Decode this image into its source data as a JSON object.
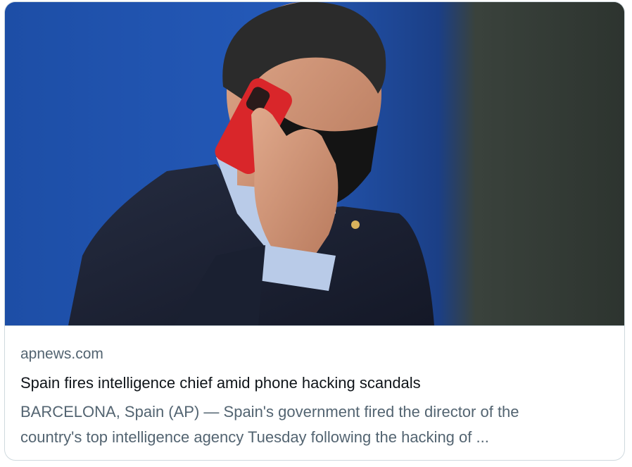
{
  "card": {
    "domain": "apnews.com",
    "title": "Spain fires intelligence chief amid phone hacking scandals",
    "description_line1": "BARCELONA, Spain (AP) — Spain's government fired the director of the",
    "description_line2": "country's top intelligence agency Tuesday following the hacking of ..."
  },
  "colors": {
    "border": "#cfd9de",
    "domain_text": "#536471",
    "title_text": "#0f1419",
    "photo_background": "#2459b8",
    "phone_case": "#d9262a",
    "suit": "#1c2233",
    "mask": "#141414"
  }
}
